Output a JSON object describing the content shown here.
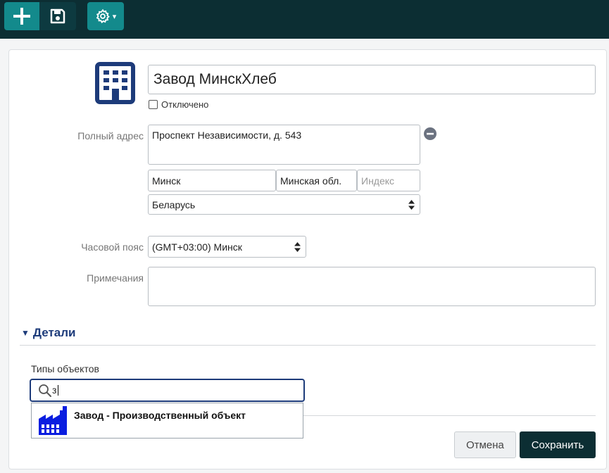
{
  "toolbar": {
    "add_icon": "plus-icon",
    "save_icon": "floppy-disk-icon",
    "settings_icon": "gear-icon",
    "settings_caret": "▾"
  },
  "form": {
    "name_value": "Завод МинскХлеб",
    "disabled_label": "Отключено",
    "address_label": "Полный адрес",
    "address_value": "Проспект Независимости, д. 543",
    "city_value": "Минск",
    "region_value": "Минская обл.",
    "postal_placeholder": "Индекс",
    "country_value": "Беларусь",
    "timezone_label": "Часовой пояс",
    "timezone_value": "(GMT+03:00) Минск",
    "notes_label": "Примечания",
    "notes_value": ""
  },
  "details": {
    "toggle": "▼",
    "title": "Детали",
    "object_types_label": "Типы объектов",
    "search_value": "з",
    "dropdown_item": "Завод - Производственный объект"
  },
  "actions": {
    "cancel_label": "Отмена",
    "save_label": "Сохранить"
  },
  "colors": {
    "topbar": "#0c2e33",
    "accent_teal": "#138a8c",
    "heading_blue": "#1d3b7a",
    "factory_blue": "#0a1ee0"
  }
}
